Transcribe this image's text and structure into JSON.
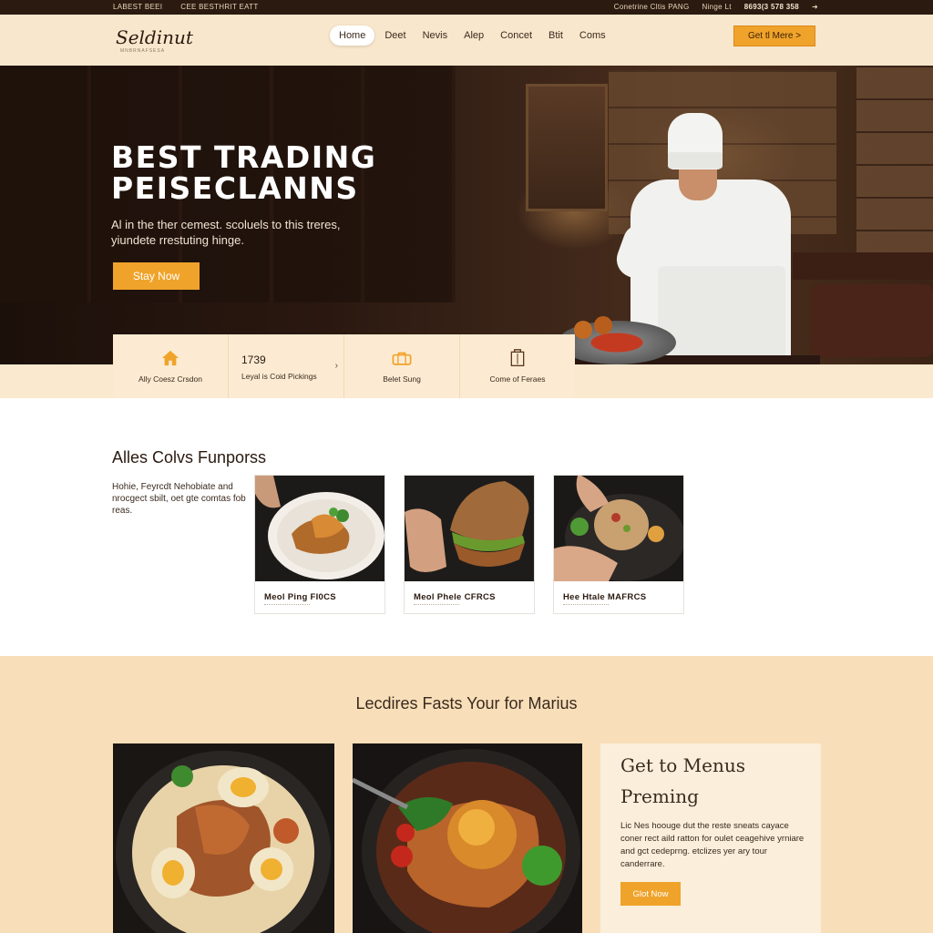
{
  "topbar": {
    "left_items": [
      "LABEST BEEI",
      "CEE BESTHRIT EATT"
    ],
    "right_items": [
      "Conetrine Cltis PANG",
      "Ninge Lt"
    ],
    "phone": "8693(3 578 358"
  },
  "header": {
    "logo": "Seldinut",
    "logo_sub": "MNBRNAFSESA",
    "nav": [
      {
        "label": "Home",
        "active": true
      },
      {
        "label": "Deet"
      },
      {
        "label": "Nevis"
      },
      {
        "label": "Alep"
      },
      {
        "label": "Concet"
      },
      {
        "label": "Btit"
      },
      {
        "label": "Coms"
      }
    ],
    "cta_label": "Get tl Mere >"
  },
  "hero": {
    "title_line1": "BEST TRADING",
    "title_line2": "PEISECLANNS",
    "subtitle": "Al in the ther cemest. scoluels to this treres, yiundete rrestuting hinge.",
    "button_label": "Stay Now"
  },
  "features": [
    {
      "icon": "home-icon",
      "label": "Ally Coesz Crsdon"
    },
    {
      "number": "1739",
      "label": "Leyal is Coid Pickings",
      "chevron": "›"
    },
    {
      "icon": "bag-icon",
      "label": "Belet Sung"
    },
    {
      "icon": "box-icon",
      "label": "Come of Feraes"
    }
  ],
  "section2": {
    "title": "Alles Colvs Funporss",
    "text": "Hohie, Feyrcdt Nehobiate and nrocgect sbilt, oet gte comtas fob reas.",
    "cards": [
      {
        "caption": "Meol Ping FI0CS"
      },
      {
        "caption": "Meol Phele CFRCS"
      },
      {
        "caption": "Hee Htale MAFRCS"
      }
    ]
  },
  "section3": {
    "title": "Lecdires Fasts Your for Marius",
    "menu_box": {
      "heading1": "Get to Menus",
      "heading2": "Preming",
      "text": "Lic Nes hoouge dut the reste sneats cayace coner rect aild ratton for oulet ceagehive yrniare and gct cedeprng. etclizes yer ary tour canderrare.",
      "button_label": "Glot Now"
    }
  },
  "colors": {
    "accent": "#f0a32a",
    "topbar": "#2b1a10",
    "nav_bg": "#f8e7cc",
    "section_bg": "#f8dfb9"
  }
}
